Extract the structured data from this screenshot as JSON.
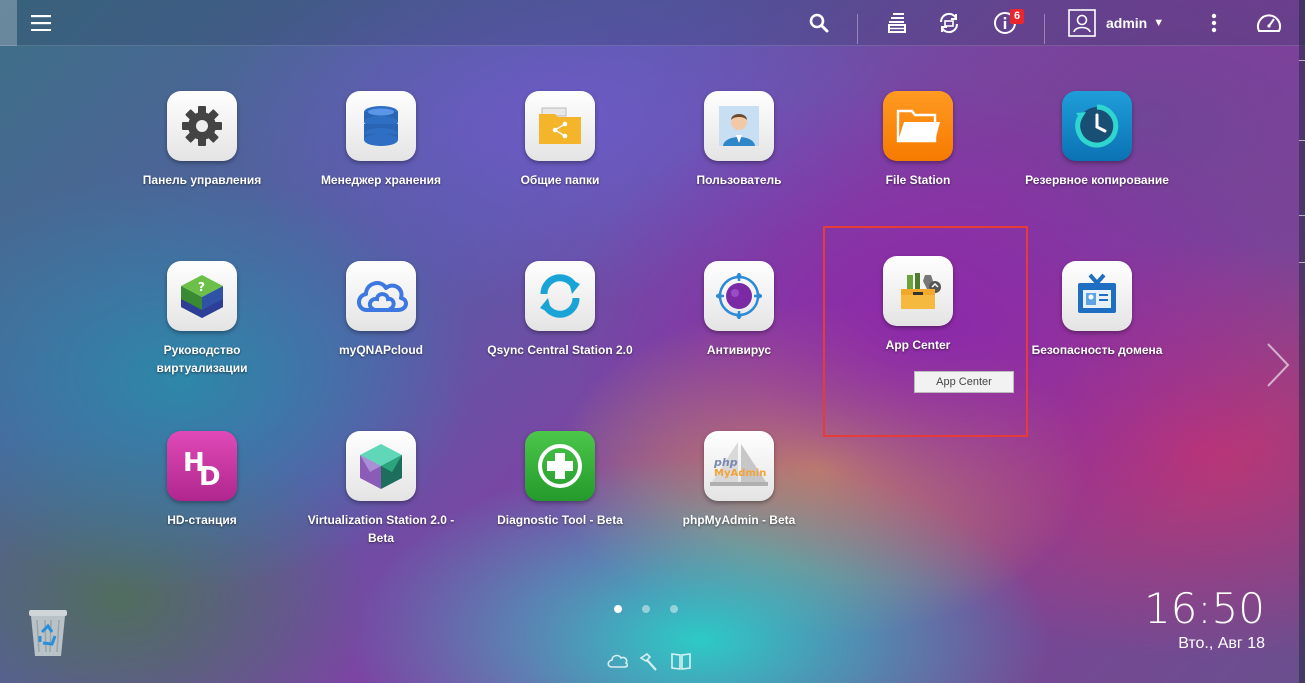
{
  "topbar": {
    "notifications_count": "6",
    "user": "admin"
  },
  "apps": [
    {
      "id": "control-panel",
      "label": "Панель управления"
    },
    {
      "id": "storage-manager",
      "label": "Менеджер хранения"
    },
    {
      "id": "shared-folders",
      "label": "Общие папки"
    },
    {
      "id": "users",
      "label": "Пользователь"
    },
    {
      "id": "file-station",
      "label": "File Station"
    },
    {
      "id": "backup",
      "label": "Резервное копирование"
    },
    {
      "id": "virtualization-guide",
      "label": "Руководство виртуализации"
    },
    {
      "id": "myqnapcloud",
      "label": "myQNAPcloud"
    },
    {
      "id": "qsync",
      "label": "Qsync Central Station 2.0"
    },
    {
      "id": "antivirus",
      "label": "Антивирус"
    },
    {
      "id": "app-center",
      "label": "App Center"
    },
    {
      "id": "domain-security",
      "label": "Безопасность домена"
    },
    {
      "id": "hd-station",
      "label": "HD-станция"
    },
    {
      "id": "virtualization-station",
      "label": "Virtualization Station 2.0 - Beta"
    },
    {
      "id": "diagnostic-tool",
      "label": "Diagnostic Tool - Beta"
    },
    {
      "id": "phpmyadmin",
      "label": "phpMyAdmin - Beta"
    }
  ],
  "tooltip": "App Center",
  "clock": {
    "time": "16:50",
    "date": "Вто., Авг 18"
  }
}
